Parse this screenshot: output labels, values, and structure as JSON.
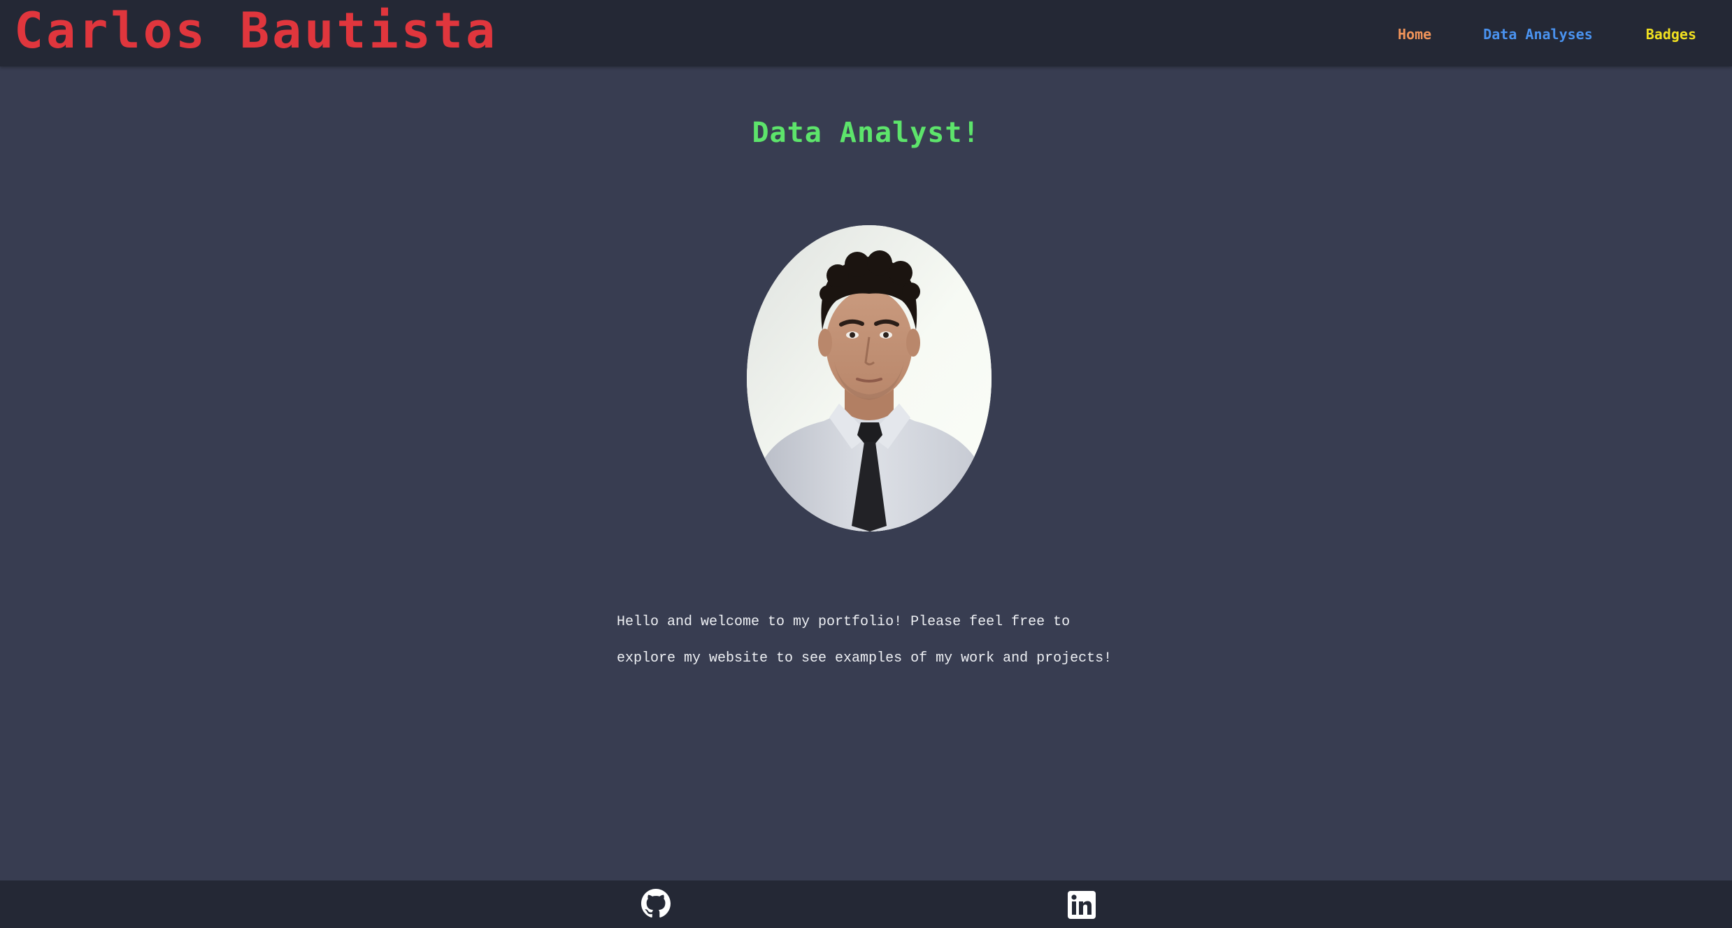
{
  "header": {
    "title": "Carlos Bautista",
    "nav": {
      "home": "Home",
      "analyses": "Data Analyses",
      "badges": "Badges"
    }
  },
  "hero": {
    "headline": "Data Analyst!",
    "portrait_icon": "profile-photo"
  },
  "intro": {
    "line1": "Hello and welcome to my portfolio! Please feel free to",
    "line2": "explore my website to see examples of my work and projects!"
  },
  "footer": {
    "icons": [
      "github-icon",
      "linkedin-icon"
    ]
  },
  "colors": {
    "background": "#383d51",
    "header_bg": "#242835",
    "title": "#e0363d",
    "home": "#f0945a",
    "analyses": "#4a93f0",
    "badges": "#f0e020",
    "headline": "#5de46b",
    "text": "#eef0f4"
  }
}
